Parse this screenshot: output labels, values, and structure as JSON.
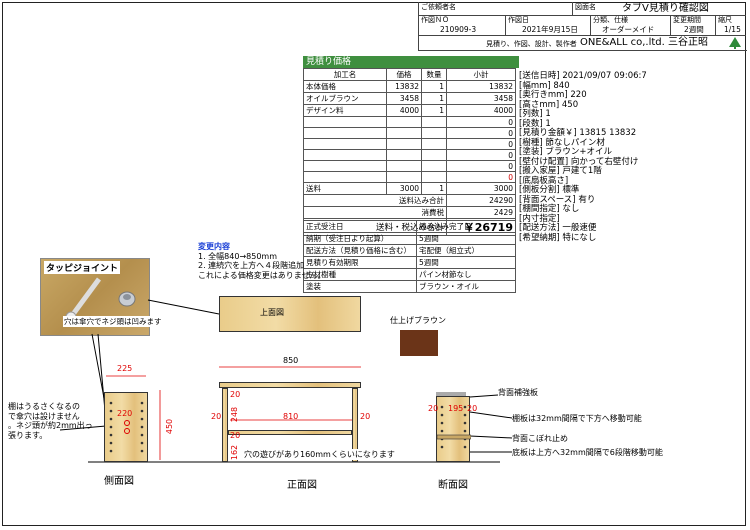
{
  "header": {
    "customer_label": "ご依頼者名",
    "drawing_name_label": "図面名",
    "drawing_name": "タブV見積り確認図",
    "fields": [
      {
        "label": "作図ＮＯ",
        "value": "210909-3"
      },
      {
        "label": "作図日",
        "value": "2021年9月15日"
      },
      {
        "label": "分類、仕様",
        "value": "オーダーメイド"
      },
      {
        "label": "変更期間",
        "value": "2週間"
      },
      {
        "label": "縮尺",
        "value": "1/15"
      }
    ],
    "company_desc": "見積り、作図、設計、製作者",
    "company": "ONE&ALL co,.ltd.  三谷正昭"
  },
  "quote": {
    "title": "見積り価格",
    "columns": [
      "加工名",
      "価格",
      "数量",
      "小計"
    ],
    "rows": [
      [
        "本体価格",
        "13832",
        "1",
        "13832"
      ],
      [
        "オイルブラウン",
        "3458",
        "1",
        "3458"
      ],
      [
        "デザイン料",
        "4000",
        "1",
        "4000"
      ],
      [
        "",
        "",
        "",
        "0"
      ],
      [
        "",
        "",
        "",
        "0"
      ],
      [
        "",
        "",
        "",
        "0"
      ],
      [
        "",
        "",
        "",
        "0"
      ],
      [
        "",
        "",
        "",
        "0"
      ],
      [
        "",
        "",
        "",
        "0"
      ]
    ],
    "shipping": [
      "送料",
      "3000",
      "1",
      "3000"
    ],
    "subtotal_label": "送料込み合計",
    "subtotal": "24290",
    "tax_label": "消費税",
    "tax": "2429",
    "total_label": "送料・税込み合計",
    "total": "￥26719",
    "terms": [
      [
        "正式受注日",
        "読み込み完了日"
      ],
      [
        "納期（受注日より起算）",
        "5週間"
      ],
      [
        "配送方法（見積り価格に含む）",
        "宅配便（組立式）"
      ],
      [
        "見積り有効期限",
        "5週間"
      ],
      [
        "主材樹種",
        "パイン材節なし"
      ],
      [
        "塗装",
        "ブラウン・オイル"
      ]
    ]
  },
  "spec": [
    "[送信日時] 2021/09/07 09:06:7",
    "[幅mm] 840",
    "[奥行きmm] 220",
    "[高さmm] 450",
    "[列数] 1",
    "[段数] 1",
    "[見積り金額￥] 13815  13832",
    "[樹種] 節なしパイン材",
    "[塗装] ブラウン+オイル",
    "[壁付け配置] 向かって右壁付け",
    "[搬入家屋] 戸建て1階",
    "[底扇板高さ]",
    "[側板分割] 標準",
    "[背面スペース] 有り",
    "[棚間指定] なし",
    "[内寸指定]",
    "[配送方法] 一般速便",
    "[希望納期] 特になし"
  ],
  "changes": {
    "title": "変更内容",
    "lines": [
      "1. 全幅840→850mm",
      "2. 連続穴を上方へ４段階追加",
      "これによる価格変更はありません。"
    ]
  },
  "tappy": {
    "title": "タッピジョイント",
    "caption": "穴は傘穴でネジ頭は凹みます"
  },
  "top_view_label": "上面図",
  "finish_label": "仕上げブラウン",
  "notes": {
    "side": [
      "棚はうるさくなるの",
      "で傘穴は設けません",
      "。ネジ頭が約2mm出っ",
      "張ります。"
    ],
    "hole_note": "穴の遊びがあり160mmくらいになります",
    "back_board": "背面補強板",
    "shelf_move": "棚板は32mm間隔で下方へ移動可能",
    "back_stop": "背面こぼれ止め",
    "bottom_move": "底板は上方へ32mm間隔で6段階移動可能"
  },
  "view_labels": {
    "side": "側面図",
    "front": "正面図",
    "section": "断面図"
  },
  "dims": {
    "side_w": "225",
    "side_in": "220",
    "side_h": "450",
    "front_w": "850",
    "front_in": "810",
    "t20a": "20",
    "t20b": "20",
    "t20c": "20",
    "t20d": "20",
    "front_h1": "248",
    "front_h2": "162",
    "sec_w": "195",
    "sec_t1": "20",
    "sec_t2": "20"
  },
  "colors": {
    "title_green": "#3f8f3f",
    "dim_red": "#e00000",
    "finish_brown": "#6b3418",
    "wood": "#efd49a"
  }
}
